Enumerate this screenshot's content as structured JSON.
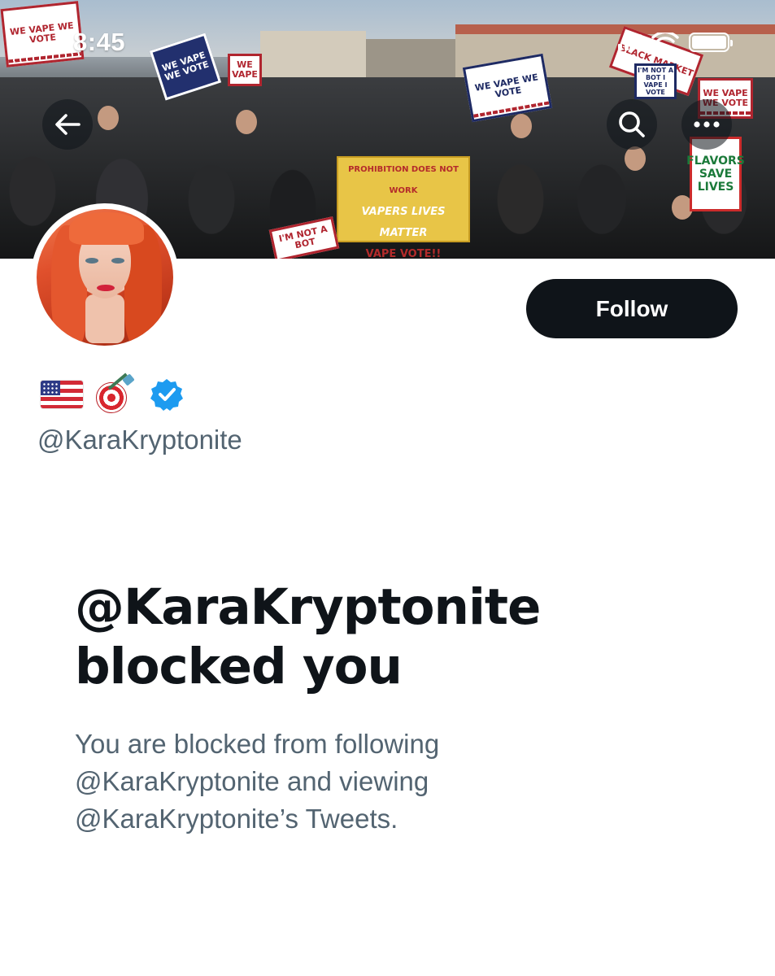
{
  "status_bar": {
    "time": "8:45"
  },
  "banner": {
    "signs": [
      "WE VAPE WE VOTE",
      "WE VAPE WE VOTE",
      "WE VAPE WE VOTE",
      "BLACK MARKET",
      "I'M NOT A BOT I VAPE I VOTE",
      "WE VAPE WE VOTE",
      "PROHIBITION DOES NOT WORK",
      "VAPERS LIVES MATTER",
      "VAPE VOTE!!",
      "FLAVORS SAVE LIVES",
      "I'M NOT A BOT",
      "WE VAPE"
    ]
  },
  "nav": {
    "back_icon": "arrow-left-icon",
    "search_icon": "search-icon",
    "more_icon": "more-horizontal-icon"
  },
  "profile": {
    "follow_label": "Follow",
    "badges": [
      "us-flag-icon",
      "dart-target-icon",
      "verified-badge-icon"
    ],
    "handle": "@KaraKryptonite"
  },
  "blocked": {
    "title_line1": "@KaraKryptonite",
    "title_line2": "blocked you",
    "desc_line1": "You are blocked from following",
    "desc_line2": "@KaraKryptonite and viewing",
    "desc_line3": "@KaraKryptonite’s Tweets."
  },
  "colors": {
    "text_primary": "#0f1419",
    "text_secondary": "#536471",
    "follow_bg": "#0f1419",
    "verified_blue": "#1d9bf0"
  }
}
